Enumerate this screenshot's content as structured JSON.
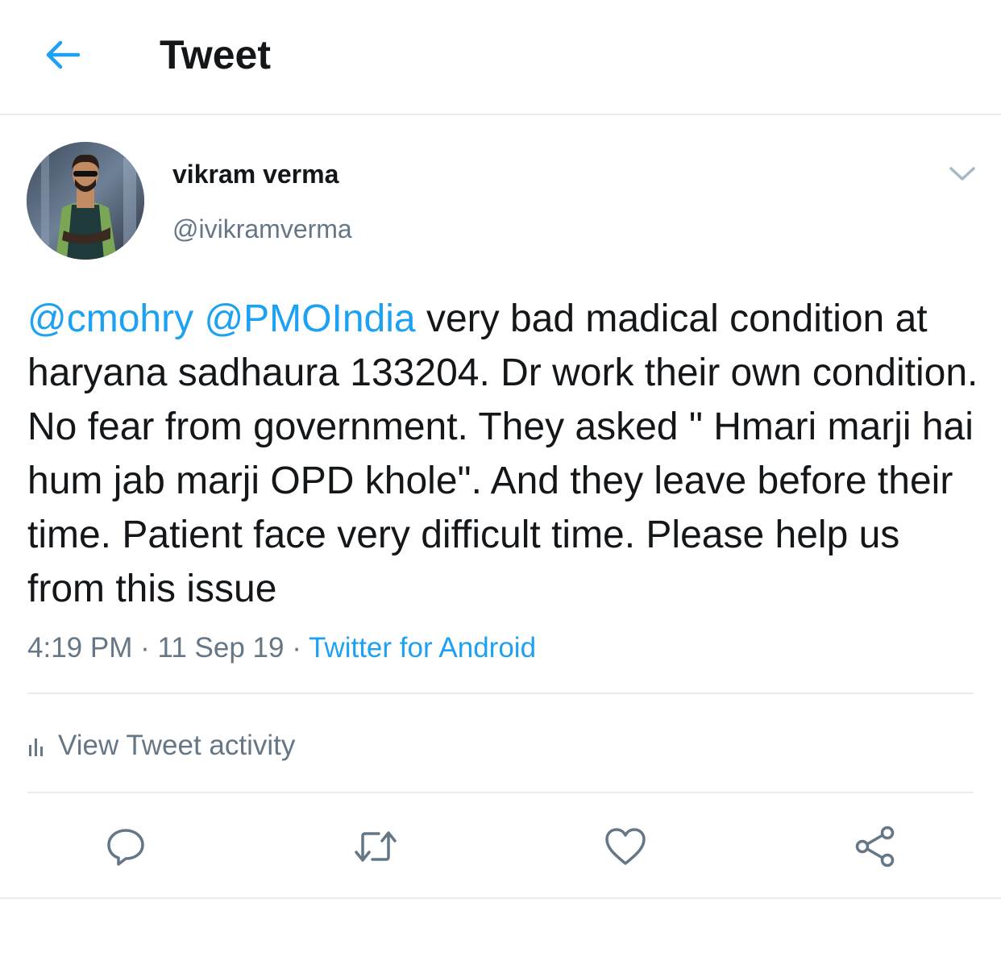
{
  "header": {
    "title": "Tweet",
    "back_icon": "arrow-left-icon"
  },
  "author": {
    "display_name": "vikram verma",
    "handle": "@ivikramverma",
    "avatar_icon": "user-avatar-photo"
  },
  "tweet": {
    "mentions": [
      "@cmohry",
      "@PMOIndia"
    ],
    "body": "very bad madical condition at haryana sadhaura 133204. Dr work their own condition. No fear from government. They asked \" Hmari marji hai hum jab marji OPD khole\". And they leave before their time. Patient face very difficult time. Please help us from this issue",
    "time": "4:19 PM",
    "date": "11 Sep 19",
    "source": "Twitter for Android",
    "separator": "·"
  },
  "activity": {
    "label": "View Tweet activity",
    "icon": "bar-chart-icon"
  },
  "actions": [
    {
      "name": "reply",
      "icon": "reply-icon"
    },
    {
      "name": "retweet",
      "icon": "retweet-icon"
    },
    {
      "name": "like",
      "icon": "heart-icon"
    },
    {
      "name": "share",
      "icon": "share-icon"
    }
  ],
  "colors": {
    "accent": "#1da1f2",
    "text": "#14171a",
    "muted": "#657786",
    "divider": "#e6ecf0"
  }
}
